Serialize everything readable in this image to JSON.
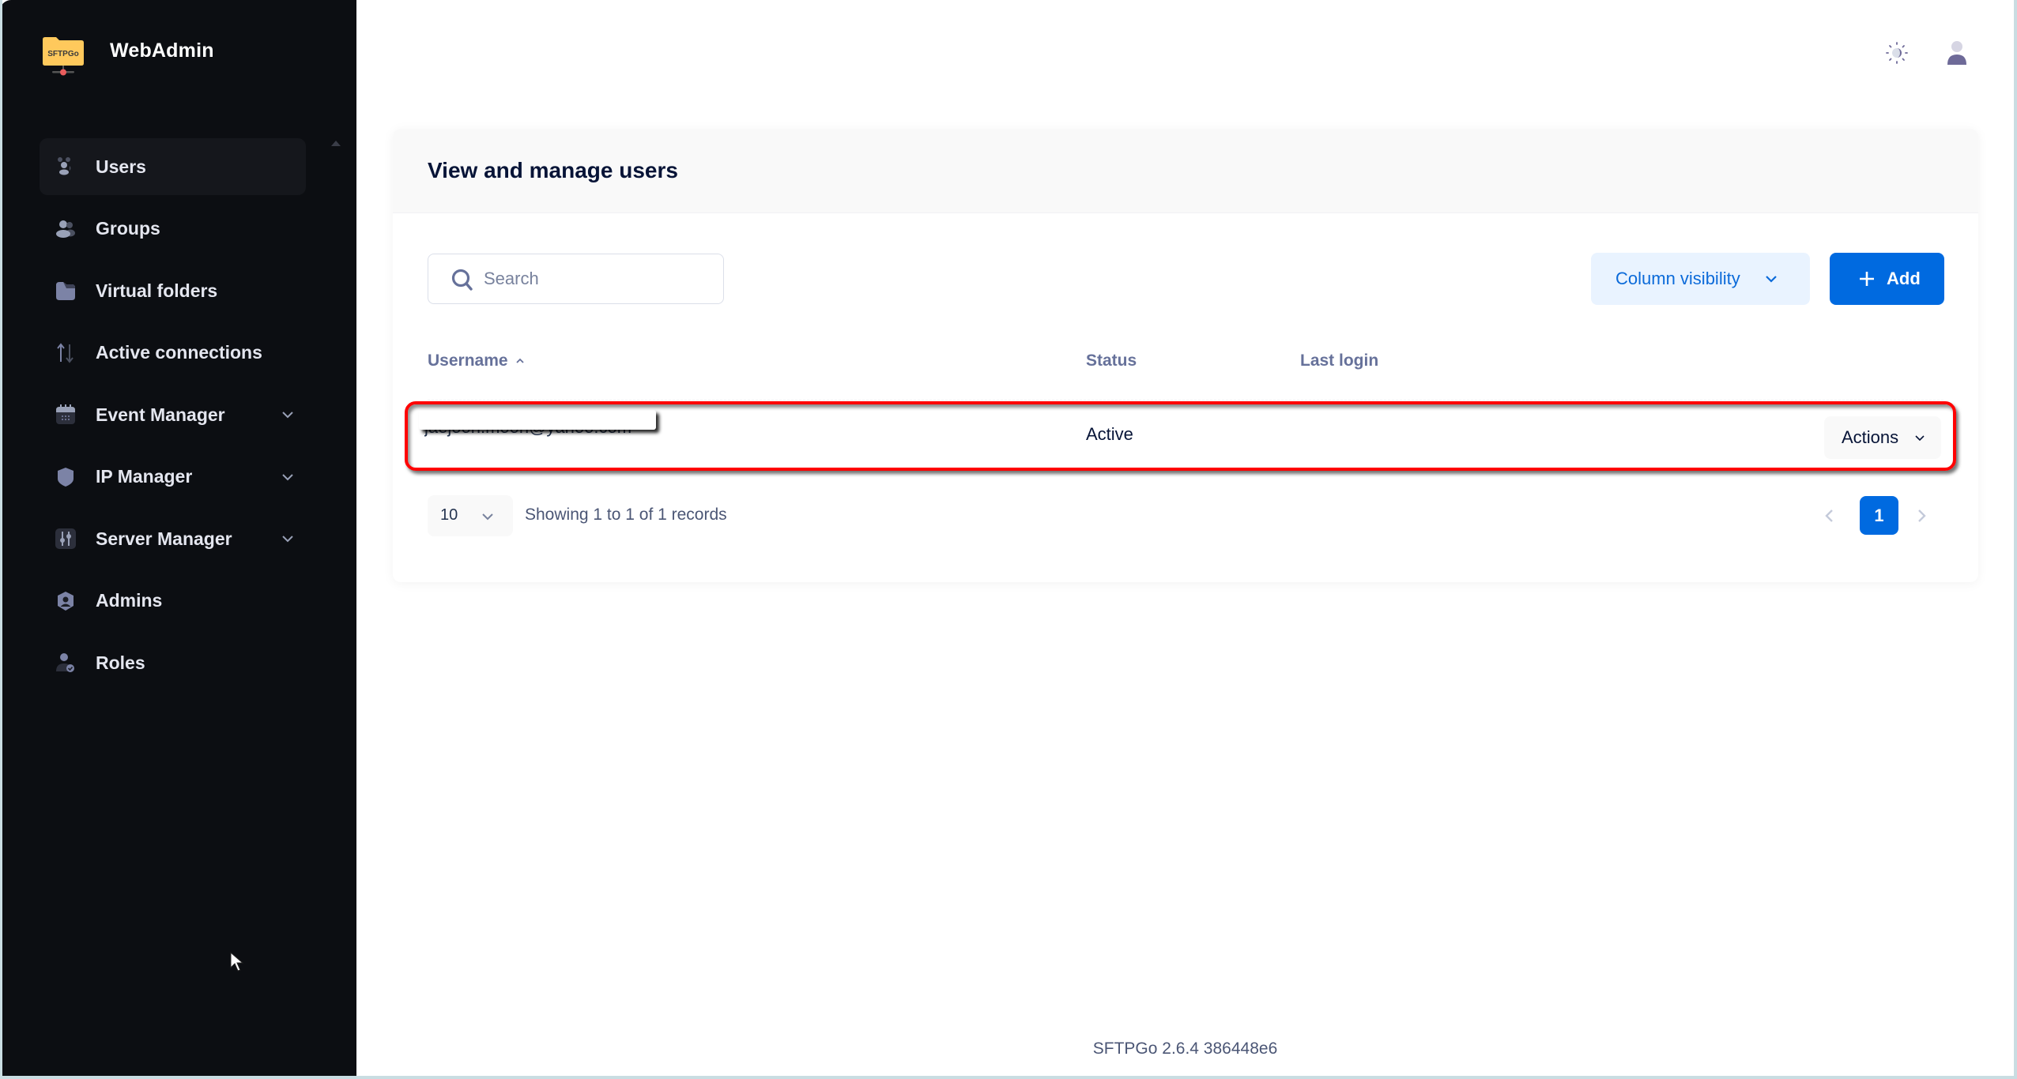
{
  "app": {
    "brand": "WebAdmin",
    "logo_text": "SFTPGo"
  },
  "sidebar": {
    "items": [
      {
        "label": "Users",
        "icon": "users-icon",
        "active": true,
        "expandable": false
      },
      {
        "label": "Groups",
        "icon": "groups-icon",
        "active": false,
        "expandable": false
      },
      {
        "label": "Virtual folders",
        "icon": "folder-icon",
        "active": false,
        "expandable": false
      },
      {
        "label": "Active connections",
        "icon": "arrows-up-down-icon",
        "active": false,
        "expandable": false
      },
      {
        "label": "Event Manager",
        "icon": "calendar-icon",
        "active": false,
        "expandable": true
      },
      {
        "label": "IP Manager",
        "icon": "shield-icon",
        "active": false,
        "expandable": true
      },
      {
        "label": "Server Manager",
        "icon": "sliders-icon",
        "active": false,
        "expandable": true
      },
      {
        "label": "Admins",
        "icon": "shield-user-icon",
        "active": false,
        "expandable": false
      },
      {
        "label": "Roles",
        "icon": "user-check-icon",
        "active": false,
        "expandable": false
      }
    ]
  },
  "header": {
    "theme_toggle_icon": "theme-toggle-icon",
    "user_menu_icon": "user-icon"
  },
  "card": {
    "title": "View and manage users",
    "search": {
      "placeholder": "Search",
      "value": ""
    },
    "column_visibility_label": "Column visibility",
    "add_label": "Add"
  },
  "table": {
    "columns": [
      {
        "label": "Username",
        "sorted": "asc"
      },
      {
        "label": "Status"
      },
      {
        "label": "Last login"
      }
    ],
    "rows": [
      {
        "username": "jaejoon.moon@yahoo.com",
        "status": "Active",
        "last_login": "",
        "actions_label": "Actions"
      }
    ]
  },
  "pagination": {
    "page_size": "10",
    "records_info": "Showing 1 to 1 of 1 records",
    "current_page": "1"
  },
  "footer": {
    "version": "SFTPGo 2.6.4 386448e6"
  },
  "colors": {
    "sidebar_bg": "#0c0e12",
    "primary": "#006ae0",
    "primary_light": "#e9f3ff",
    "highlight": "#ff0000"
  }
}
